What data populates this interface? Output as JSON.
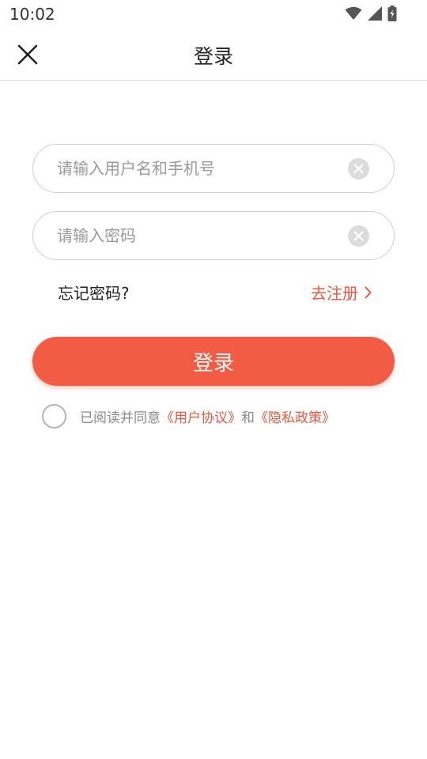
{
  "status_bar": {
    "time": "10:02",
    "icons": [
      "wifi-icon",
      "cellular-signal-icon",
      "battery-charging-icon"
    ]
  },
  "nav": {
    "close_icon": "close-icon",
    "title": "登录"
  },
  "form": {
    "username": {
      "value": "",
      "placeholder": "请输入用户名和手机号",
      "clear_icon": "clear-icon"
    },
    "password": {
      "value": "",
      "placeholder": "请输入密码",
      "clear_icon": "clear-icon"
    },
    "forgot_label": "忘记密码?",
    "register_label": "去注册",
    "register_icon": "chevron-right-icon",
    "login_label": "登录"
  },
  "agreement": {
    "checked": false,
    "prefix": "已阅读并同意",
    "user_agreement": "《用户协议》",
    "conjunction": "和",
    "privacy_policy": "《隐私政策》"
  },
  "colors": {
    "accent": "#f25c45",
    "link": "#e8573f",
    "border": "#cfcfcf",
    "placeholder": "#9a9a9a"
  }
}
